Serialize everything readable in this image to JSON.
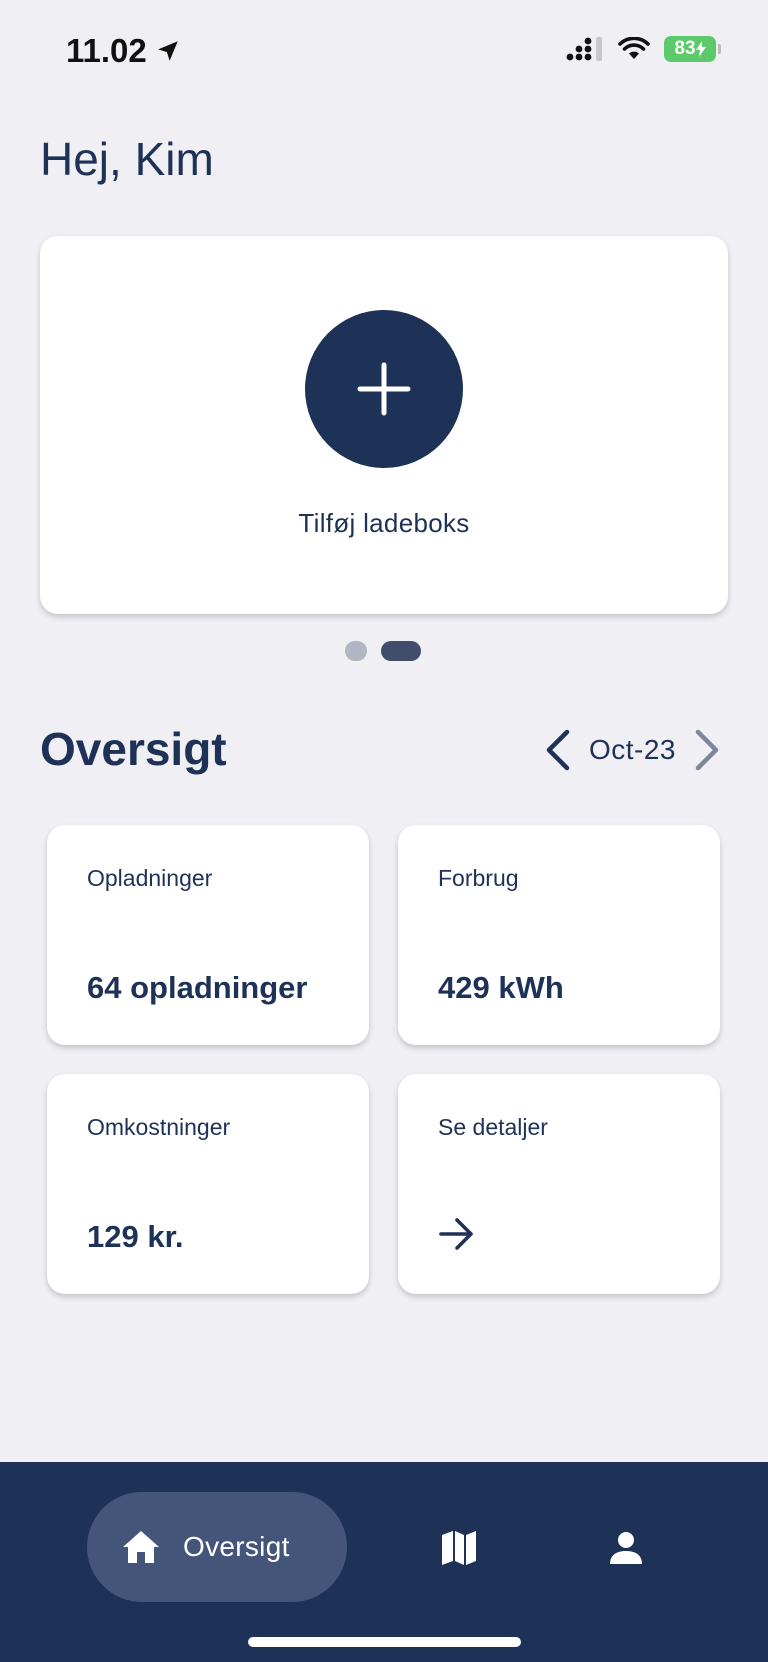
{
  "status_bar": {
    "time": "11.02",
    "battery": "83"
  },
  "greeting": "Hej, Kim",
  "add_card": {
    "label": "Tilføj ladeboks"
  },
  "pager": {
    "count": 2,
    "active_index": 1
  },
  "overview": {
    "title": "Oversigt",
    "month": "Oct-23",
    "tiles": [
      {
        "label": "Opladninger",
        "value": "64 opladninger"
      },
      {
        "label": "Forbrug",
        "value": "429 kWh"
      },
      {
        "label": "Omkostninger",
        "value": "129 kr."
      },
      {
        "label": "Se detaljer"
      }
    ]
  },
  "bottom_nav": {
    "items": [
      {
        "label": "Oversigt",
        "icon": "home-icon",
        "active": true
      },
      {
        "icon": "map-icon"
      },
      {
        "icon": "profile-icon"
      }
    ]
  },
  "colors": {
    "primary": "#1e3157",
    "background": "#f0eff4",
    "nav_active": "#45557a",
    "battery": "#5cc96a"
  }
}
